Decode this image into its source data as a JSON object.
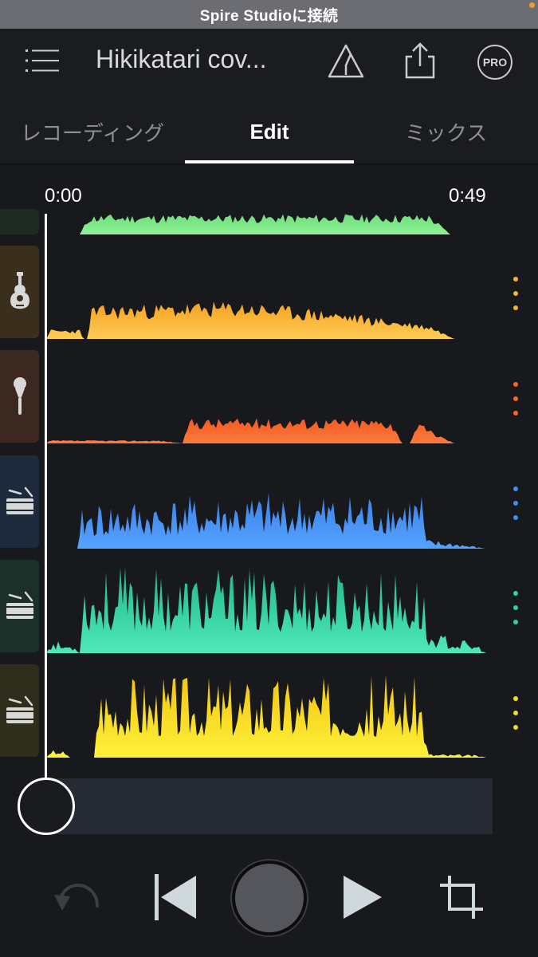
{
  "status_bar": {
    "title": "Spire Studioに接続"
  },
  "header": {
    "song_title": "Hikikatari cov...",
    "pro_badge": "PRO",
    "icons": [
      "menu-icon",
      "metronome-warning-icon",
      "share-icon",
      "pro-badge"
    ]
  },
  "tabs": [
    {
      "label": "レコーディング",
      "active": false
    },
    {
      "label": "Edit",
      "active": true
    },
    {
      "label": "ミックス",
      "active": false
    }
  ],
  "timeline": {
    "start": "0:00",
    "end": "0:49"
  },
  "tracks": [
    {
      "icon": "partial-track",
      "color": "#6fde78",
      "tile": "#1f2b22"
    },
    {
      "icon": "acoustic-guitar-icon",
      "color": "#f7b42c",
      "tile": "#3a2f1d"
    },
    {
      "icon": "microphone-icon",
      "color": "#f5672a",
      "tile": "#3a2821"
    },
    {
      "icon": "snare-drum-icon",
      "color": "#3e8ff2",
      "tile": "#1c2a3b"
    },
    {
      "icon": "snare-drum-icon",
      "color": "#2fd3a0",
      "tile": "#1b3029"
    },
    {
      "icon": "snare-drum-icon",
      "color": "#f5dc1c",
      "tile": "#2f2e1c"
    }
  ],
  "transport": {
    "icons": [
      "undo-icon",
      "previous-icon",
      "record-button",
      "play-icon",
      "crop-icon"
    ]
  }
}
